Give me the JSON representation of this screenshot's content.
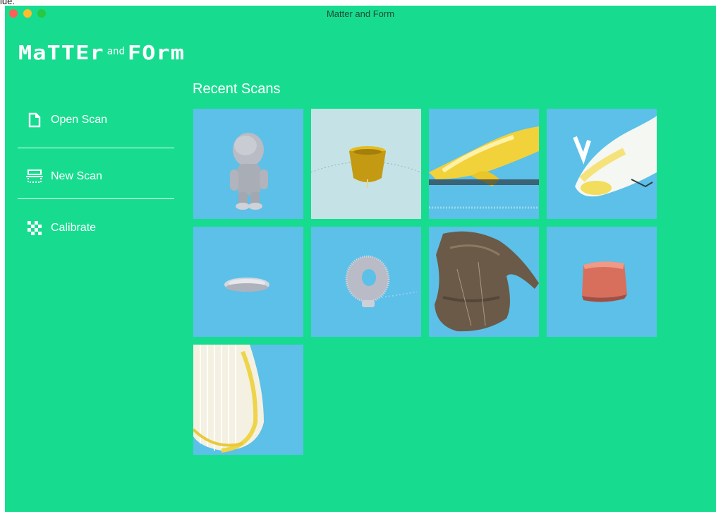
{
  "window": {
    "title": "Matter and Form"
  },
  "logo": {
    "part1": "MaTTEr",
    "part2": "and",
    "part3": "FOrm"
  },
  "sidebar": {
    "items": [
      {
        "label": "Open Scan",
        "icon": "open-file-icon"
      },
      {
        "label": "New Scan",
        "icon": "scanner-icon"
      },
      {
        "label": "Calibrate",
        "icon": "checkerboard-icon"
      }
    ]
  },
  "main": {
    "heading": "Recent Scans",
    "scans": [
      {
        "subject": "figurine"
      },
      {
        "subject": "yellow-cup"
      },
      {
        "subject": "yellow-point-cloud"
      },
      {
        "subject": "white-point-cloud"
      },
      {
        "subject": "flat-disc"
      },
      {
        "subject": "ring"
      },
      {
        "subject": "brown-mesh"
      },
      {
        "subject": "red-block"
      },
      {
        "subject": "yellow-streaks"
      }
    ]
  },
  "colors": {
    "background": "#17dc8f",
    "tile": "#5cc0e8",
    "tile_alt": "#c5e3e6",
    "text": "#ffffff"
  }
}
